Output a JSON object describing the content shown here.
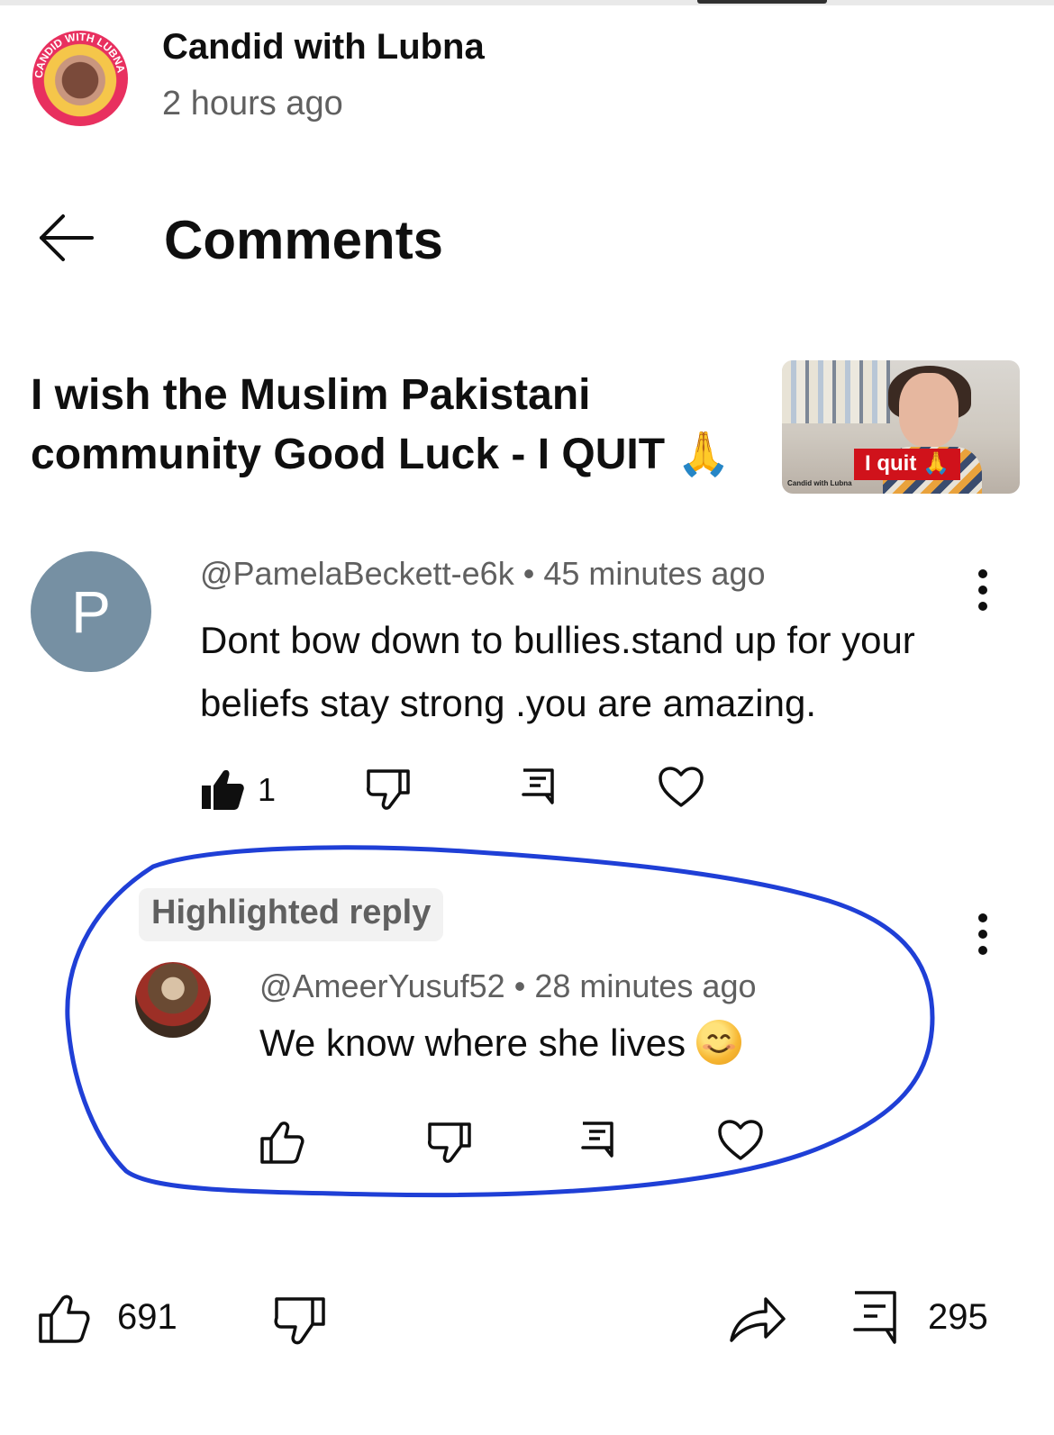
{
  "channel": {
    "name": "Candid with Lubna",
    "time": "2 hours ago",
    "avatar_ring_text": "CANDID WITH LUBNA"
  },
  "header": {
    "title": "Comments"
  },
  "post": {
    "text": "I wish the Muslim Pakistani community Good Luck - I QUIT 🙏",
    "thumbnail": {
      "badge": "I quit 🙏",
      "caption": "Candid with Lubna"
    }
  },
  "comment": {
    "avatar_letter": "P",
    "author": "@PamelaBeckett-e6k",
    "time": "45 minutes ago",
    "text": "Dont bow down to bullies.stand up for your beliefs stay strong .you are amazing.",
    "like_count": "1"
  },
  "reply": {
    "badge": "Highlighted reply",
    "author": "@AmeerYusuf52",
    "time": "28 minutes ago",
    "text": "We know where she lives"
  },
  "bottom_bar": {
    "like_count": "691",
    "comment_count": "295"
  },
  "colors": {
    "text_primary": "#0f0f0f",
    "text_secondary": "#606060",
    "avatar_p": "#7690a3",
    "annotation_stroke": "#1f3fd6",
    "thumb_badge": "#d0121b"
  },
  "icons": [
    "back-arrow-icon",
    "more-vertical-icon",
    "thumb-up-icon",
    "thumb-down-icon",
    "reply-icon",
    "heart-icon",
    "share-icon",
    "comment-icon"
  ]
}
